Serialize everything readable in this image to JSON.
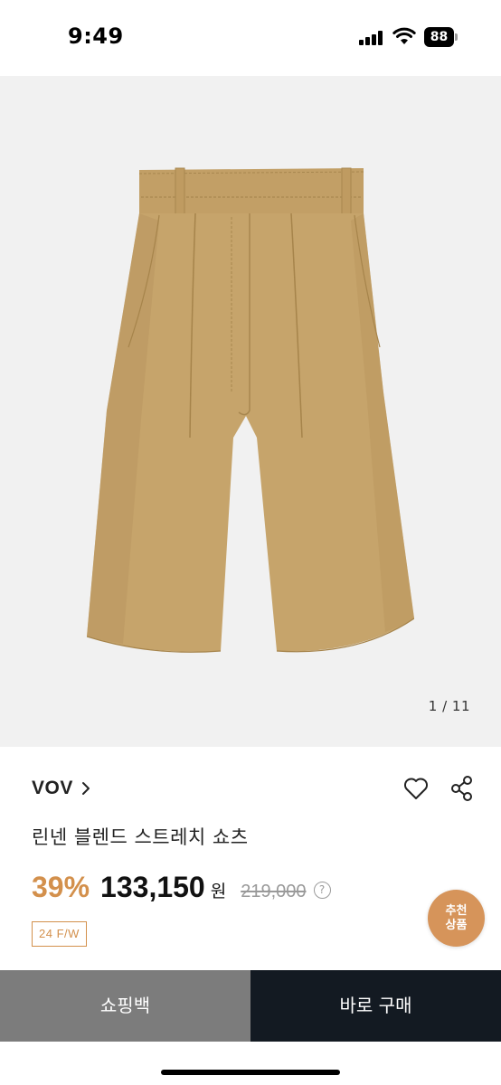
{
  "status_bar": {
    "time": "9:49",
    "battery": "88"
  },
  "gallery": {
    "page_indicator": "1 / 11",
    "image_subject": "beige pleated linen shorts"
  },
  "product": {
    "brand": "VOV",
    "title": "린넨 블렌드 스트레치 쇼츠",
    "discount": "39%",
    "price": "133,150",
    "currency": "원",
    "original_price": "219,000",
    "help_mark": "?",
    "season_tag": "24 F/W"
  },
  "recommend": {
    "line1": "추천",
    "line2": "상품"
  },
  "actions": {
    "cart_label": "쇼핑백",
    "buy_label": "바로 구매"
  },
  "colors": {
    "accent": "#d3904c",
    "buy_button": "#131a22",
    "cart_button": "#7c7c7c",
    "product_khaki": "#c4a26a"
  }
}
